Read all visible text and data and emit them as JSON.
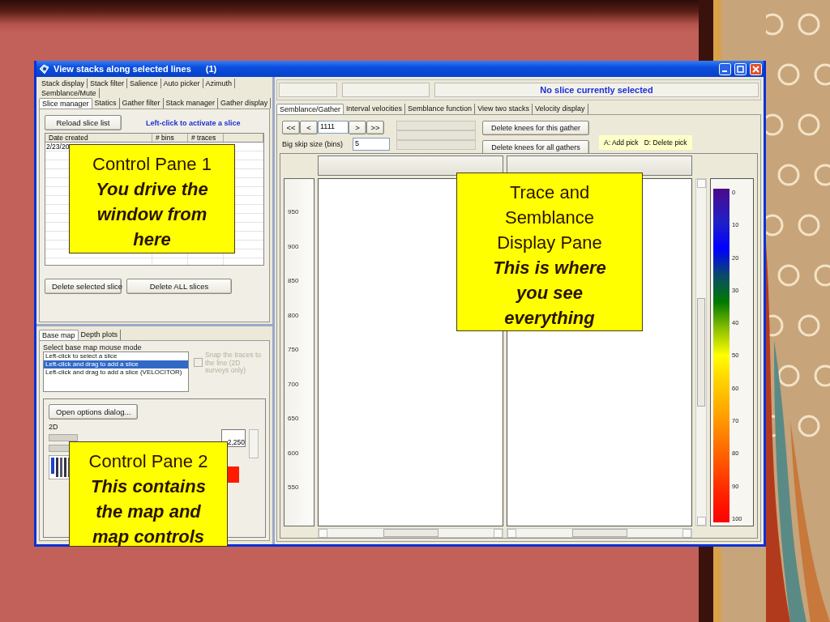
{
  "window": {
    "title": "View stacks along selected lines",
    "title_count": "(1)"
  },
  "control_pane_1": {
    "tab_rows": [
      {
        "tabs": [
          {
            "label": "Stack display",
            "selected": false
          },
          {
            "label": "Stack filter",
            "selected": false
          },
          {
            "label": "Salience",
            "selected": false
          },
          {
            "label": "Auto picker",
            "selected": false
          },
          {
            "label": "Azimuth",
            "selected": false
          }
        ]
      },
      {
        "tabs": [
          {
            "label": "Semblance/Mute",
            "selected": false
          }
        ]
      },
      {
        "tabs": [
          {
            "label": "Slice manager",
            "selected": true
          },
          {
            "label": "Statics",
            "selected": false
          },
          {
            "label": "Gather filter",
            "selected": false
          },
          {
            "label": "Stack manager",
            "selected": false
          },
          {
            "label": "Gather display",
            "selected": false
          }
        ]
      }
    ],
    "reload_button": "Reload slice list",
    "hint": "Left-click to activate a slice",
    "table": {
      "columns": [
        "Date created",
        "# bins",
        "# traces"
      ],
      "rows": [
        [
          "2/23/20"
        ]
      ]
    },
    "buttons": [
      "Delete selected slice",
      "Delete ALL slices"
    ]
  },
  "control_pane_2": {
    "tabs": [
      {
        "label": "Base map",
        "selected": true
      },
      {
        "label": "Depth plots",
        "selected": false
      }
    ],
    "mode_label": "Select base map mouse mode",
    "modes": [
      {
        "label": "Left-click to select a slice",
        "selected": false
      },
      {
        "label": "Left-click and drag to add a slice",
        "selected": true
      },
      {
        "label": "Left-click and drag to add a slice (VELOCITOR)",
        "selected": false
      }
    ],
    "snap_checkbox": {
      "label": "Snap the traces to the line (2D surveys only)",
      "checked": false,
      "disabled": true
    },
    "options_button": "Open options dialog...",
    "dimension": "2D",
    "map_value": "2,250"
  },
  "display_pane": {
    "status_message": "No slice currently selected",
    "tabs": [
      {
        "label": "Semblance/Gather",
        "selected": true
      },
      {
        "label": "Interval velocities",
        "selected": false
      },
      {
        "label": "Semblance function",
        "selected": false
      },
      {
        "label": "View two stacks",
        "selected": false
      },
      {
        "label": "Velocity display",
        "selected": false
      }
    ],
    "nav_back": [
      "<<",
      "<"
    ],
    "gather_number": "1111",
    "nav_forward": [
      ">",
      ">>"
    ],
    "knee_buttons": [
      "Delete knees for this gather",
      "Delete knees for all gathers"
    ],
    "skip_label": "Big skip size (bins)",
    "skip_value": "5",
    "key_hint": "A: Add pick   D: Delete pick",
    "depth_ticks": [
      "950",
      "900",
      "850",
      "800",
      "750",
      "700",
      "650",
      "600",
      "550"
    ],
    "color_scale": [
      "0",
      "10",
      "20",
      "30",
      "40",
      "50",
      "60",
      "70",
      "80",
      "90",
      "100"
    ]
  },
  "callouts": [
    {
      "title": "Control Pane 1",
      "subtitle": "You drive the window from here"
    },
    {
      "title": "Control Pane 2",
      "subtitle": "This contains the map and map controls"
    },
    {
      "title": "Trace and Semblance Display Pane",
      "subtitle": "This is where you see everything"
    }
  ]
}
